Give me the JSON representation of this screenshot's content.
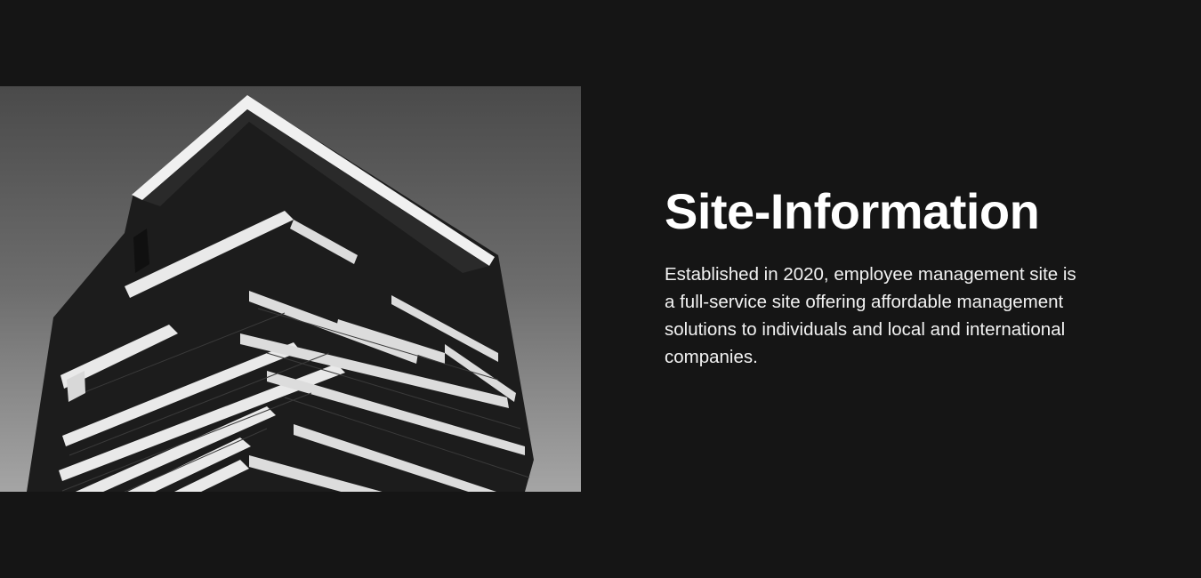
{
  "section": {
    "image": {
      "icon": "building-photo"
    },
    "title": "Site-Information",
    "description": "Established in 2020, employee management site is a full-service site offering affordable management solutions to individuals and local and international companies."
  },
  "colors": {
    "background": "#151515",
    "text": "#ffffff"
  }
}
